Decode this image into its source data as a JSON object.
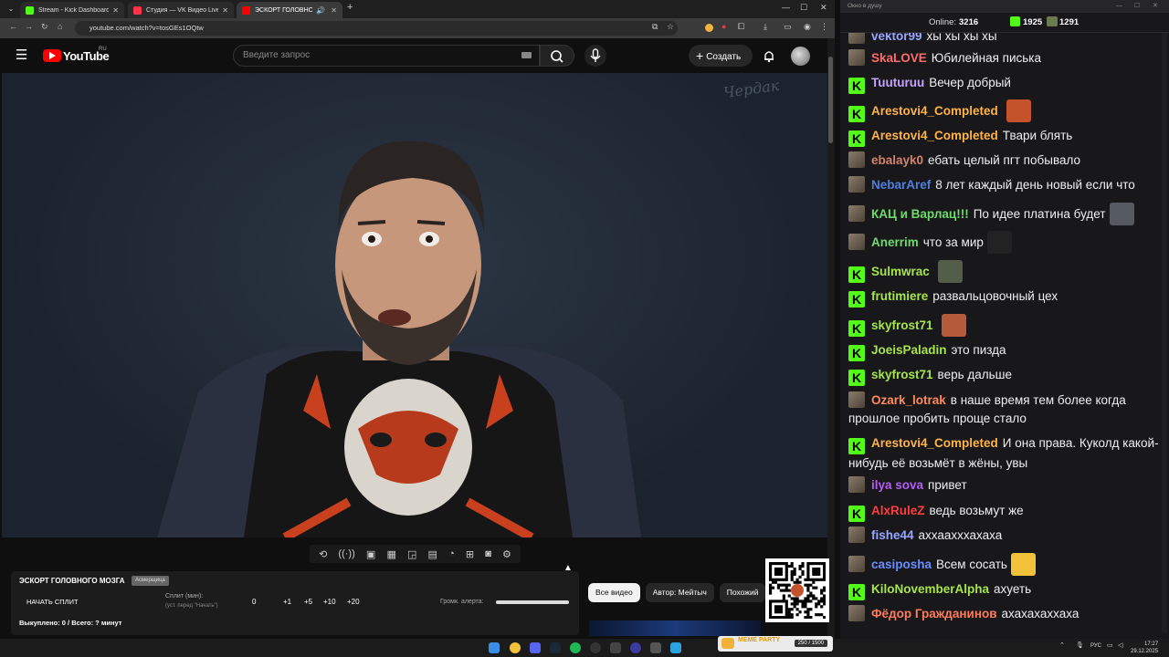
{
  "browser": {
    "tabs": [
      {
        "title": "Stream - Kick Dashboard",
        "color": "#53fc18"
      },
      {
        "title": "Студия — VK Видео Live",
        "color": "#ff3347"
      },
      {
        "title": "ЭСКОРТ ГОЛОВНОГО МОЗ",
        "color": "#ff0000",
        "active": true
      }
    ],
    "url": "youtube.com/watch?v=tosGEs1OQtw"
  },
  "youtube": {
    "logo_text": "YouTube",
    "country": "RU",
    "search_placeholder": "Введите запрос",
    "create_label": "Создать",
    "video_watermark": "Чердак"
  },
  "panel": {
    "title": "ЭСКОРТ ГОЛОВНОГО МОЗГА",
    "badge": "Асмерщица",
    "split_button": "НАЧАТЬ СПЛИТ",
    "split_label": "Сплит (мин):",
    "split_hint": "(уст. перед \"Начать\")",
    "split_value": "0",
    "increments": [
      "+1",
      "+5",
      "+10",
      "+20"
    ],
    "volume_label": "Громк. алерта:",
    "volume_value": 1.0,
    "status": "Выкуплено: 0 / Всего: ? минут"
  },
  "chips": [
    "Все видео",
    "Автор: Мейтыч",
    "Похожий"
  ],
  "chat": {
    "window_title": "Окно в душу",
    "online_label": "Online:",
    "online_value": "3216",
    "kick_count": "1925",
    "other_count": "1291",
    "messages": [
      {
        "badge": "ava",
        "name": "vektor99",
        "color": "#9aa7ff",
        "text": "хы хы хы хы",
        "emote": null
      },
      {
        "badge": "ava",
        "name": "SkaLOVE",
        "color": "#ff6b6b",
        "text": "Юбилейная писька",
        "emote": null
      },
      {
        "badge": "kick",
        "name": "Tuuturuu",
        "color": "#c5a3ff",
        "text": "Вечер добрый",
        "emote": null
      },
      {
        "badge": "kick",
        "name": "Arestovi4_Completed",
        "color": "#ffb347",
        "text": "",
        "emote": "#c4522a"
      },
      {
        "badge": "kick",
        "name": "Arestovi4_Completed",
        "color": "#ffb347",
        "text": "Твари блять",
        "emote": null
      },
      {
        "badge": "ava",
        "name": "ebalayk0",
        "color": "#d4826a",
        "text": "ебать целый пгт побывало",
        "emote": null
      },
      {
        "badge": "ava",
        "name": "NebarAref",
        "color": "#4f7fdc",
        "text": "8 лет каждый день новый если что",
        "emote": null
      },
      {
        "badge": "ava",
        "name": "КАЦ и Варлац!!!",
        "color": "#6edc6a",
        "text": "По идее платина будет",
        "emote": "#555a60"
      },
      {
        "badge": "ava",
        "name": "Anerrim",
        "color": "#6edc6a",
        "text": "что за мир",
        "emote": "#222"
      },
      {
        "badge": "kick",
        "name": "Sulmwrac",
        "color": "#a6e34d",
        "text": "",
        "emote": "#545d48"
      },
      {
        "badge": "kick",
        "name": "frutimiere",
        "color": "#a6e34d",
        "text": "развальцовочный цех",
        "emote": null
      },
      {
        "badge": "kick",
        "name": "skyfrost71",
        "color": "#a6e34d",
        "text": "",
        "emote": "#b55a3a"
      },
      {
        "badge": "kick",
        "name": "JoeisPaladin",
        "color": "#a6e34d",
        "text": "это пизда",
        "emote": null
      },
      {
        "badge": "kick",
        "name": "skyfrost71",
        "color": "#a6e34d",
        "text": "верь дальше",
        "emote": null
      },
      {
        "badge": "ava",
        "name": "Ozark_lotrak",
        "color": "#ff8a5c",
        "text": "в наше время тем более когда прошлое пробить проще стало",
        "emote": null
      },
      {
        "badge": "kick",
        "name": "Arestovi4_Completed",
        "color": "#ffb347",
        "text": "И она права. Куколд какой-нибудь её возьмёт в жёны, увы",
        "emote": null
      },
      {
        "badge": "ava",
        "name": "ilya sova",
        "color": "#b65cf0",
        "text": "привет",
        "emote": null
      },
      {
        "badge": "kick",
        "name": "AlxRuleZ",
        "color": "#ff3d3d",
        "text": "ведь возьмут же",
        "emote": null
      },
      {
        "badge": "ava",
        "name": "fishe44",
        "color": "#9aa7ff",
        "text": "аххаахххахаха",
        "emote": null
      },
      {
        "badge": "ava",
        "name": "casiposha",
        "color": "#6a8cff",
        "text": "Всем сосать",
        "emote": "#f2c23a"
      },
      {
        "badge": "kick",
        "name": "KiloNovemberAlpha",
        "color": "#a6e34d",
        "text": "ахуеть",
        "emote": null
      },
      {
        "badge": "ava",
        "name": "Фёдор Гражданинов",
        "color": "#ff7b5c",
        "text": "ахахахаххаха",
        "emote": null
      }
    ]
  },
  "taskbar": {
    "lang": "РУС",
    "time": "17:27",
    "date": "29.12.2025",
    "meme_label": "MEME PARTY",
    "meme_value": "250 / 1500"
  }
}
